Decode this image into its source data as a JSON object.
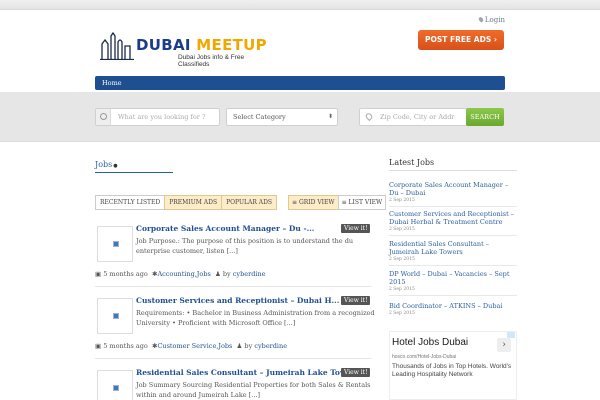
{
  "header": {
    "login_label": "Login",
    "logo_main_dubai": "DUBAI",
    "logo_main_meetup": "MEETUP",
    "logo_tagline": "Dubai Jobs info & Free Classifieds",
    "post_ad_label": "POST FREE ADS"
  },
  "nav": {
    "home_label": "Home"
  },
  "search": {
    "keyword_placeholder": "What are you looking for ?",
    "category_value": "Select Category",
    "location_placeholder": "Zip Code, City or Addr",
    "button_label": "SEARCH"
  },
  "main": {
    "section_title": "Jobs",
    "tabs": [
      "RECENTLY LISTED",
      "PREMIUM ADS",
      "POPULAR ADS"
    ],
    "grid_label": "GRID VIEW",
    "list_label": "LIST VIEW",
    "view_label": "View it!",
    "jobs": [
      {
        "title": "Corporate Sales Account Manager – Du -...",
        "desc": "Job Purpose.: The purpose of this position is to understand the du enterprise customer, listen [...]",
        "age": "5 months ago",
        "categories": "Accounting,Jobs",
        "by": "by",
        "author": "cyberdine"
      },
      {
        "title": "Customer Services and Receptionist – Dubai H...",
        "desc": "Requirements: • Bachelor in Business Administration from a recognized University • Proficient with Microsoft Office [...]",
        "age": "5 months ago",
        "categories": "Customer Service,Jobs",
        "by": "by",
        "author": "cyberdine"
      },
      {
        "title": "Residential Sales Consultant – Jumeirah Lake Tow...",
        "desc": "Job Summary Sourcing Residential Properties for both Sales & Rentals within and around Jumeirah Lake [...]",
        "age": "",
        "categories": "",
        "by": "",
        "author": ""
      }
    ]
  },
  "sidebar": {
    "latest_title": "Latest Jobs",
    "latest": [
      {
        "title": "Corporate Sales Account Manager – Du – Dubai",
        "date": "2 Sep 2015"
      },
      {
        "title": "Customer Services and Receptionist – Dubai Herbal & Treatment Centre",
        "date": "2 Sep 2015"
      },
      {
        "title": "Residential Sales Consultant – Jumeirah Lake Towers",
        "date": "2 Sep 2015"
      },
      {
        "title": "DP World – Dubai – Vacancies – Sept 2015",
        "date": "2 Sep 2015"
      },
      {
        "title": "Bid Coordinator – ATKINS – Dubai",
        "date": "2 Sep 2015"
      }
    ],
    "ad": {
      "headline": "Hotel Jobs Dubai",
      "url": "hosco.com/Hotel-Jobs-Dubai",
      "body": "Thousands of Jobs in Top Hotels. World's Leading Hospitality Network",
      "arrow": "›"
    }
  },
  "colors": {
    "nav": "#1e4f91",
    "post_button": "#e8602a",
    "search_button": "#7ab83e"
  }
}
